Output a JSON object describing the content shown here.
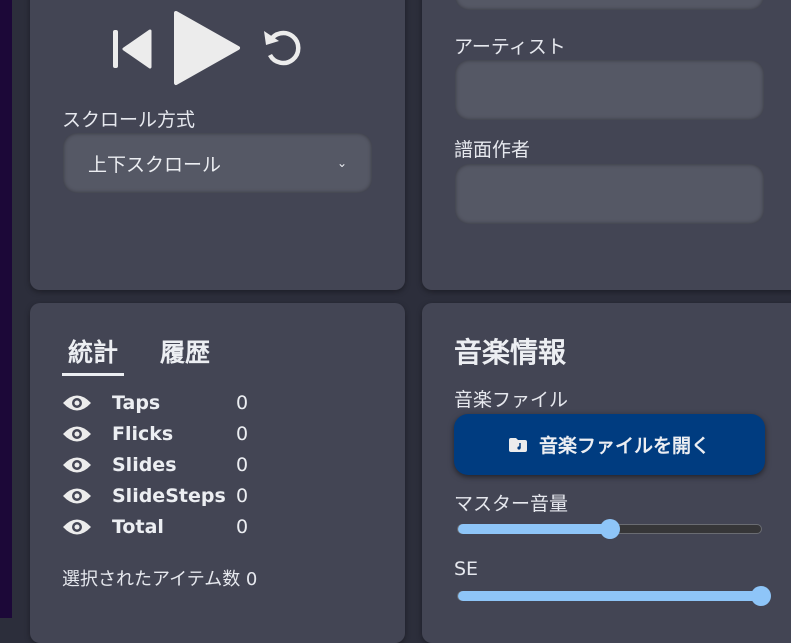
{
  "player": {
    "scroll_label": "スクロール方式",
    "scroll_value": "上下スクロール"
  },
  "meta": {
    "artist_label": "アーティスト",
    "charter_label": "譜面作者"
  },
  "stats": {
    "tabs": [
      "統計",
      "履歴"
    ],
    "rows": [
      {
        "name": "Taps",
        "value": "0"
      },
      {
        "name": "Flicks",
        "value": "0"
      },
      {
        "name": "Slides",
        "value": "0"
      },
      {
        "name": "SlideSteps",
        "value": "0"
      },
      {
        "name": "Total",
        "value": "0"
      }
    ],
    "selected": "選択されたアイテム数 0"
  },
  "music": {
    "title": "音楽情報",
    "file_label": "音楽ファイル",
    "open_button": "音楽ファイルを開く",
    "master_label": "マスター音量",
    "master_value": 0.5,
    "se_label": "SE",
    "se_value": 1.0
  },
  "colors": {
    "accent": "#8ec5f8",
    "button": "#003c80"
  }
}
